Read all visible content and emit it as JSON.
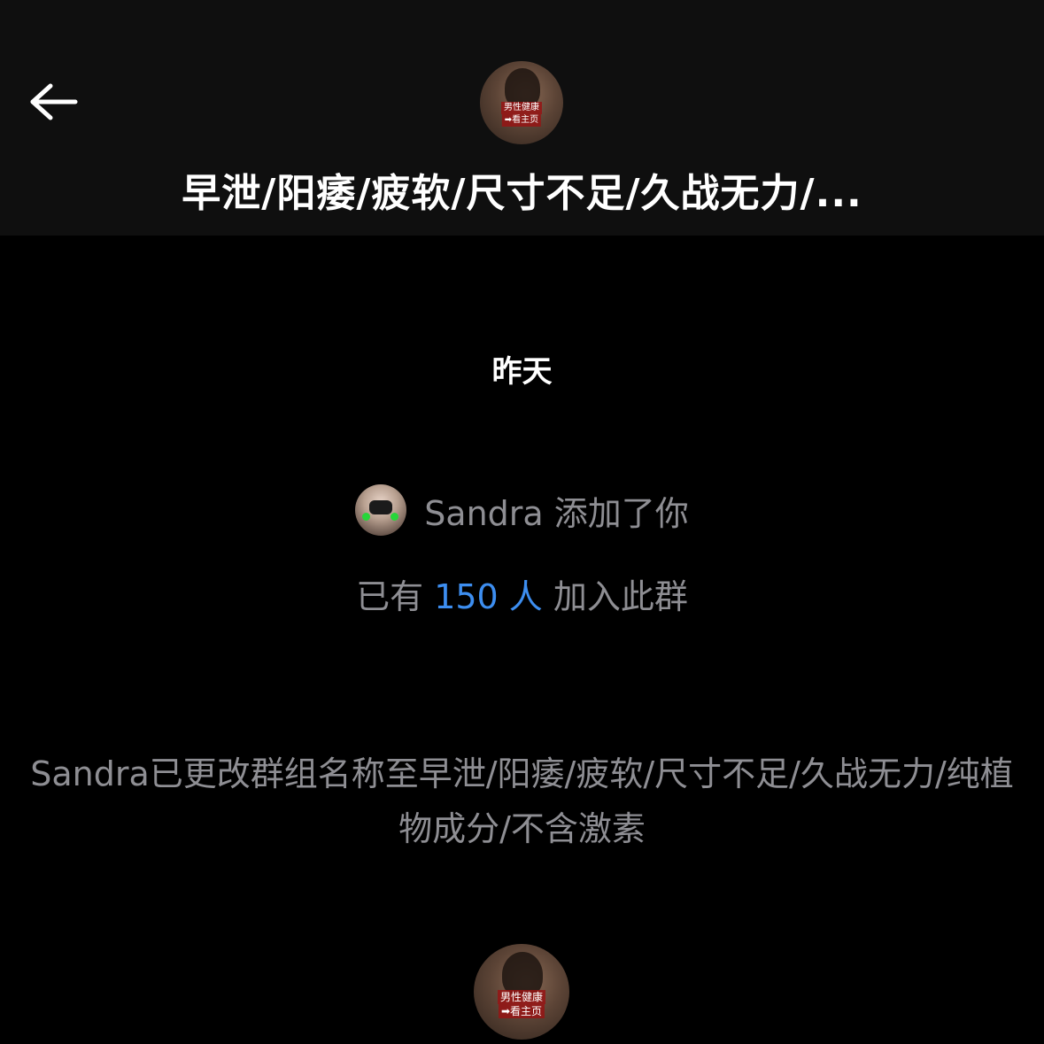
{
  "header": {
    "back_icon": "arrow-left-icon",
    "group_title": "早泄/阳痿/疲软/尺寸不足/久战无力/...",
    "avatar_tag_line1": "男性健康",
    "avatar_tag_line2": "➡看主页"
  },
  "messages": {
    "date_label": "昨天",
    "added": {
      "text": "Sandra 添加了你"
    },
    "members": {
      "prefix": "已有",
      "count": "150 人",
      "suffix": "加入此群"
    },
    "rename": {
      "text": "Sandra已更改群组名称至早泄/阳痿/疲软/尺寸不足/久战无力/纯植物成分/不含激素"
    }
  },
  "bottom_avatar": {
    "tag_line1": "男性健康",
    "tag_line2": "➡看主页"
  },
  "colors": {
    "background": "#000000",
    "header_background": "#0f0f0f",
    "muted_text": "#8e8e93",
    "accent": "#3d8ef0"
  }
}
